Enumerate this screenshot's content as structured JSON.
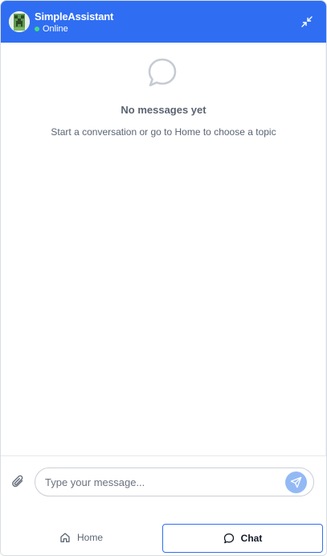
{
  "header": {
    "title": "SimpleAssistant",
    "status": "Online",
    "avatar_icon": "creeper-avatar-icon",
    "minimize_icon": "minimize-arrows-icon",
    "background_color": "#2f6ef2",
    "status_color": "#3ddc84"
  },
  "empty_state": {
    "icon": "chat-bubble-icon",
    "title": "No messages yet",
    "subtitle": "Start a conversation or go to Home to choose a topic"
  },
  "composer": {
    "attach_icon": "paperclip-icon",
    "placeholder": "Type your message...",
    "value": "",
    "send_icon": "send-icon",
    "send_color": "#93b9f5"
  },
  "tabs": [
    {
      "label": "Home",
      "icon": "home-icon",
      "active": false
    },
    {
      "label": "Chat",
      "icon": "chat-bubble-icon",
      "active": true
    }
  ]
}
